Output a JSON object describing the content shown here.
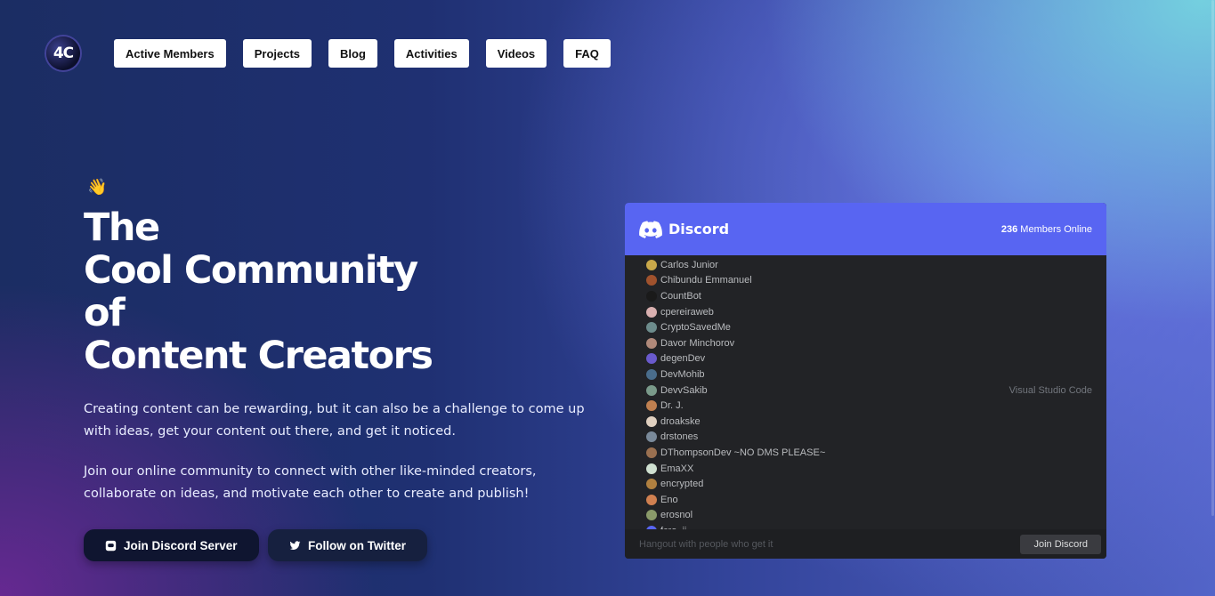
{
  "logo": {
    "text": "4C"
  },
  "nav": [
    "Active Members",
    "Projects",
    "Blog",
    "Activities",
    "Videos",
    "FAQ"
  ],
  "hero": {
    "emoji": "👋",
    "title_lines": [
      "The",
      "Cool Community",
      "of",
      "Content Creators"
    ],
    "paragraph1": "Creating content can be rewarding, but it can also be a challenge to come up with ideas, get your content out there, and get it noticed.",
    "paragraph2": "Join our online community to connect with other like-minded creators, collaborate on ideas, and motivate each other to create and publish!",
    "cta_discord": "Join Discord Server",
    "cta_twitter": "Follow on Twitter"
  },
  "discord_widget": {
    "brand": "Discord",
    "members_online_count": "236",
    "members_online_label": "Members Online",
    "members": [
      {
        "name": "Carlos Junior",
        "activity": "",
        "color": "#c9a84a"
      },
      {
        "name": "Chibundu Emmanuel",
        "activity": "",
        "color": "#a0522d"
      },
      {
        "name": "CountBot",
        "activity": "",
        "color": "#1a1a1a"
      },
      {
        "name": "cpereiraweb",
        "activity": "",
        "color": "#d9b0b0"
      },
      {
        "name": "CryptoSavedMe",
        "activity": "",
        "color": "#6d8c8c"
      },
      {
        "name": "Davor Minchorov",
        "activity": "",
        "color": "#b0897a"
      },
      {
        "name": "degenDev",
        "activity": "",
        "color": "#6a5acd"
      },
      {
        "name": "DevMohib",
        "activity": "",
        "color": "#4a6d8c"
      },
      {
        "name": "DevvSakib",
        "activity": "Visual Studio Code",
        "color": "#7a9a8a"
      },
      {
        "name": "Dr. J.",
        "activity": "",
        "color": "#c08050"
      },
      {
        "name": "droakske",
        "activity": "",
        "color": "#e0d0c0"
      },
      {
        "name": "drstones",
        "activity": "",
        "color": "#7a8a9a"
      },
      {
        "name": "DThompsonDev ~NO DMS PLEASE~",
        "activity": "",
        "color": "#9a7050"
      },
      {
        "name": "EmaXX",
        "activity": "",
        "color": "#cfe0d0"
      },
      {
        "name": "encrypted",
        "activity": "",
        "color": "#b08040"
      },
      {
        "name": "Eno",
        "activity": "",
        "color": "#d08050"
      },
      {
        "name": "erosnol",
        "activity": "",
        "color": "#8a9a6a"
      },
      {
        "name": "fcro_ji",
        "activity": "",
        "color": "#5865f2"
      }
    ],
    "footer_tagline": "Hangout with people who get it",
    "join_label": "Join Discord"
  }
}
